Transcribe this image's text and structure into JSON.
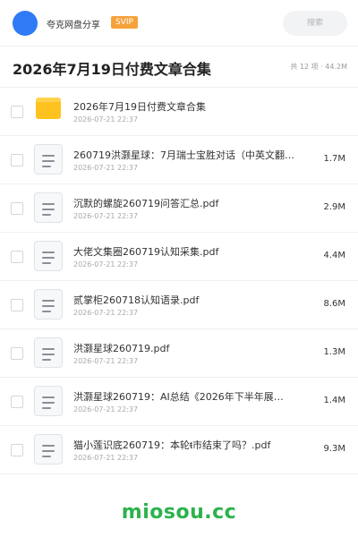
{
  "topbar": {
    "username": "夸克网盘分享",
    "badge": "SVIP",
    "search_placeholder": "搜索"
  },
  "header": {
    "title": "2026年7月19日付费文章合集",
    "summary": "共 12 项 · 44.2M"
  },
  "files": [
    {
      "name": "2026年7月19日付费文章合集",
      "date": "2026-07-21 22:37",
      "size": "",
      "icon": "folder-icon"
    },
    {
      "name": "260719洪灏星球：7月瑞士宝胜对话（中英文翻译…",
      "date": "2026-07-21 22:37",
      "size": "1.7M",
      "icon": "document-icon"
    },
    {
      "name": "沉默的螺旋260719问答汇总.pdf",
      "date": "2026-07-21 22:37",
      "size": "2.9M",
      "icon": "document-icon"
    },
    {
      "name": "大佬文集圈260719认知采集.pdf",
      "date": "2026-07-21 22:37",
      "size": "4.4M",
      "icon": "document-icon"
    },
    {
      "name": "贰掌柜260718认知语录.pdf",
      "date": "2026-07-21 22:37",
      "size": "8.6M",
      "icon": "document-icon"
    },
    {
      "name": "洪灏星球260719.pdf",
      "date": "2026-07-21 22:37",
      "size": "1.3M",
      "icon": "document-icon"
    },
    {
      "name": "洪灏星球260719：AI总结《2026年下半年展…",
      "date": "2026-07-21 22:37",
      "size": "1.4M",
      "icon": "document-icon"
    },
    {
      "name": "猫小莲识底260719：本轮ᵵ市结束了吗？.pdf",
      "date": "2026-07-21 22:37",
      "size": "9.3M",
      "icon": "document-icon"
    }
  ],
  "footer": {
    "watermark": "miosou.cc"
  },
  "colors": {
    "avatar": "#2f7bf6",
    "badge": "#f6a23b",
    "folder": "#ffc21f",
    "watermark": "#2bb24c"
  }
}
